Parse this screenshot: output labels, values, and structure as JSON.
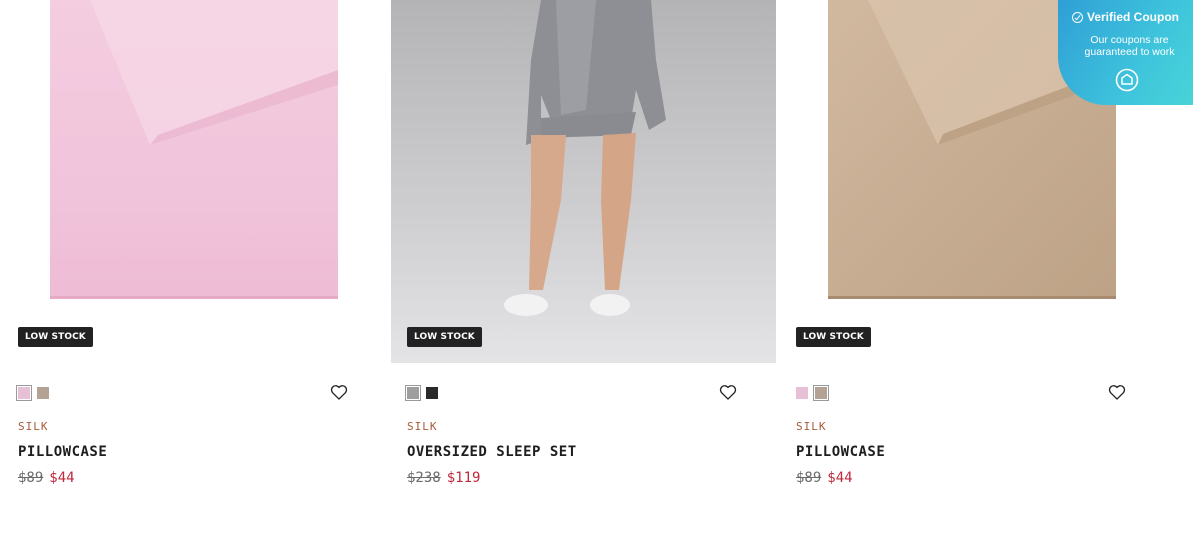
{
  "products": [
    {
      "badge": "LOW STOCK",
      "category": "SILK",
      "name": "PILLOWCASE",
      "old_price": "$89",
      "new_price": "$44",
      "swatches": [
        {
          "color": "#e8c0d6",
          "selected": true
        },
        {
          "color": "#b4a294",
          "selected": false
        }
      ]
    },
    {
      "badge": "LOW STOCK",
      "category": "SILK",
      "name": "OVERSIZED SLEEP SET",
      "old_price": "$238",
      "new_price": "$119",
      "swatches": [
        {
          "color": "#9e9e9e",
          "selected": true
        },
        {
          "color": "#2a2a2a",
          "selected": false
        }
      ]
    },
    {
      "badge": "LOW STOCK",
      "category": "SILK",
      "name": "PILLOWCASE",
      "old_price": "$89",
      "new_price": "$44",
      "swatches": [
        {
          "color": "#e8c0d6",
          "selected": false
        },
        {
          "color": "#b4a294",
          "selected": true
        }
      ]
    }
  ],
  "coupon": {
    "title": "Verified Coupon",
    "line1": "Our coupons are",
    "line2": "guaranteed to work"
  },
  "colors": {
    "price_sale": "#c0283c",
    "category": "#a65a3a",
    "badge_bg": "#222222",
    "coupon_gradient_start": "#2f9fd6",
    "coupon_gradient_end": "#48d4d8"
  }
}
